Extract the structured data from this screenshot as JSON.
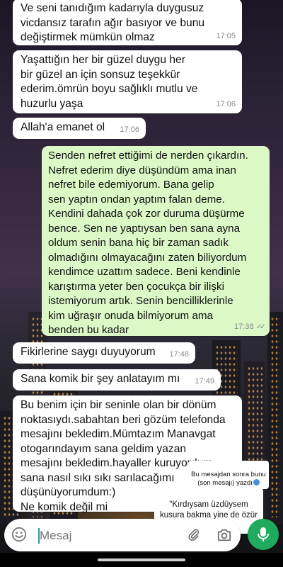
{
  "messages": [
    {
      "text": "Ve seni tanıdığım kadarıyla duygusuz\nvicdansız tarafın ağır basıyor ve bunu\ndeğiştirmek mümkün olmaz",
      "time": "17:05"
    },
    {
      "text": "Yaşattığın her bir güzel duygu her\nbir güzel an için sonsuz teşekkür\nederim.ömrün boyu sağlıklı mutlu ve\nhuzurlu yaşa",
      "time": "17:06"
    },
    {
      "text": "Allah'a emanet ol",
      "time": "17:06"
    },
    {
      "text": "Senden nefret ettiğimi de nerden çıkardın.\nNefret ederim diye düşündüm ama inan\nnefret bile edemiyorum.  Bana gelip\nsen yaptın ondan yaptım falan deme.\nKendini dahada çok zor duruma düşürme\nbence. Sen ne yaptıysan ben sana ayna\noldum senin bana hiç bir zaman sadık\nolmadığını olmayacağını zaten biliyordum\nkendimce uzattım sadece. Beni kendinle\nkarıştırma yeter ben çocukça bir ilişki\nistemiyorum artık.  Senin bencilliklerinle\nkim uğraşır onuda bilmiyorum ama\nbenden bu kadar",
      "time": "17:38"
    },
    {
      "text": "Fikirlerine saygı duyuyorum",
      "time": "17:48"
    },
    {
      "text": "Sana komik bir şey anlatayım mı",
      "time": "17:49"
    },
    {
      "text": "Bu benim için bir seninle olan bir dönüm\nnoktasıydı.sabahtan beri gözüm telefonda\nmesajını bekledim.Mümtazım Manavgat\notogarındayım sana geldim yazan\nmesajını bekledim.hayaller kuruyordum\nsana nasıl sıkı sıkı sarılacağımı\ndüşünüyorumdum:)\nNe komik değil mi",
      "time": ""
    }
  ],
  "annotations": {
    "note1": "Bu mesajdan sonra bunu\n(son mesajı) yazdı",
    "note2": "\"Kırdıysam üzdüysem\nkusura bakma yine de özür\ndilerim\""
  },
  "input": {
    "placeholder": "Mesaj"
  },
  "colors": {
    "incoming": "#ffffff",
    "outgoing": "#dbf8c6",
    "accent": "#1faa5e"
  },
  "icons": [
    "emoji-icon",
    "attach-icon",
    "camera-icon",
    "mic-icon",
    "read-ticks-icon"
  ]
}
